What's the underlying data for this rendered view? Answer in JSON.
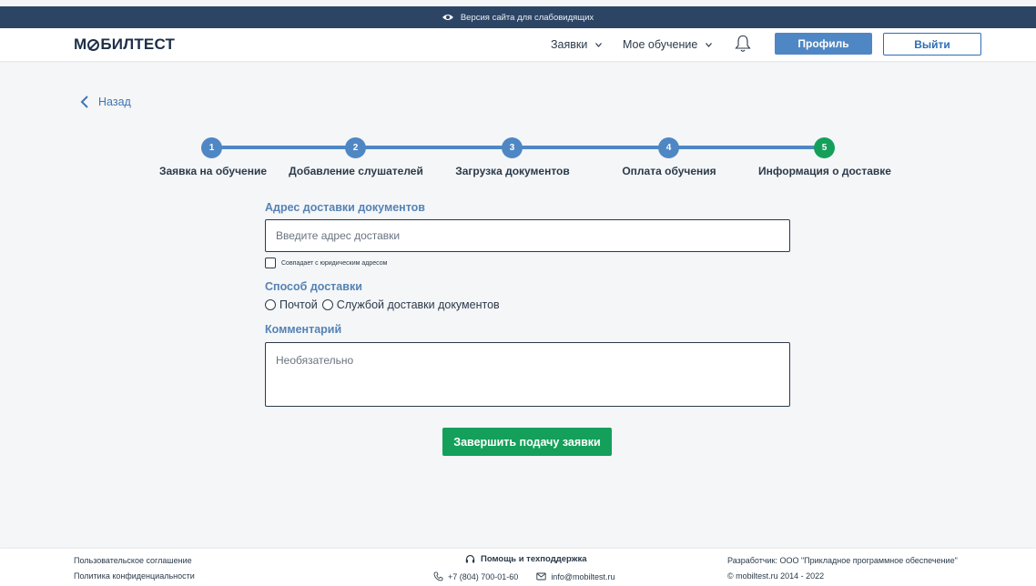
{
  "topbar": {
    "text": "Версия сайта для слабовидящих"
  },
  "header": {
    "logo": {
      "part1": "М",
      "part2": "БИЛТЕСТ"
    },
    "nav": [
      {
        "label": "Заявки"
      },
      {
        "label": "Мое обучение"
      }
    ],
    "profile_label": "Профиль",
    "logout_label": "Выйти"
  },
  "back_label": "Назад",
  "steps": [
    {
      "number": "1",
      "label": "Заявка на обучение",
      "status": "completed"
    },
    {
      "number": "2",
      "label": "Добавление слушателей",
      "status": "completed"
    },
    {
      "number": "3",
      "label": "Загрузка документов",
      "status": "completed"
    },
    {
      "number": "4",
      "label": "Оплата обучения",
      "status": "completed"
    },
    {
      "number": "5",
      "label": "Информация о доставке",
      "status": "current"
    }
  ],
  "form": {
    "address_label": "Адрес доставки документов",
    "address_placeholder": "Введите адрес доставки",
    "address_value": "",
    "same_as_legal_label": "Совпадает с юридическим адресом",
    "same_as_legal_checked": false,
    "delivery_label": "Способ доставки",
    "delivery_options": [
      {
        "label": "Почтой",
        "selected": false
      },
      {
        "label": "Службой доставки документов",
        "selected": false
      }
    ],
    "comment_label": "Комментарий",
    "comment_placeholder": "Необязательно",
    "submit_label": "Завершить подачу заявки"
  },
  "footer": {
    "user_agreement": "Пользовательское соглашение",
    "privacy_policy": "Политика конфиденциальности",
    "help_title": "Помощь и техподдержка",
    "phone": "+7 (804) 700-01-60",
    "email": "info@mobiltest.ru",
    "developer": "Разработчик: ООО \"Прикладное программное обеспечение\"",
    "copyright": "© mobiltest.ru 2014 - 2022"
  },
  "colors": {
    "topbar": "#2d4565",
    "accent": "#4f87c4",
    "success": "#14a05a",
    "label": "#5583b4",
    "background": "#f5f6f8"
  },
  "icons": [
    "eye-icon",
    "chevron-down-icon",
    "bell-icon",
    "chevron-left-icon",
    "headset-icon",
    "phone-icon",
    "mail-icon"
  ]
}
